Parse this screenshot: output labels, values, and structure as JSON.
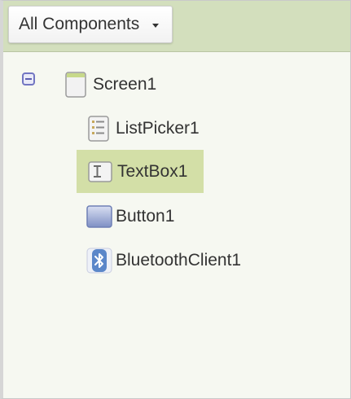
{
  "dropdown": {
    "label": "All Components"
  },
  "tree": {
    "root": {
      "label": "Screen1",
      "icon": "screen-icon",
      "expanded": true
    },
    "children": [
      {
        "label": "ListPicker1",
        "icon": "listpicker-icon",
        "selected": false
      },
      {
        "label": "TextBox1",
        "icon": "textbox-icon",
        "selected": true
      },
      {
        "label": "Button1",
        "icon": "button-icon",
        "selected": false
      },
      {
        "label": "BluetoothClient1",
        "icon": "bluetooth-icon",
        "selected": false
      }
    ]
  },
  "colors": {
    "header_bg": "#d3dfbd",
    "panel_bg": "#f6f8f1",
    "selection_bg": "#d3dfa7",
    "toggle_color": "#7276c2",
    "text": "#333333"
  }
}
